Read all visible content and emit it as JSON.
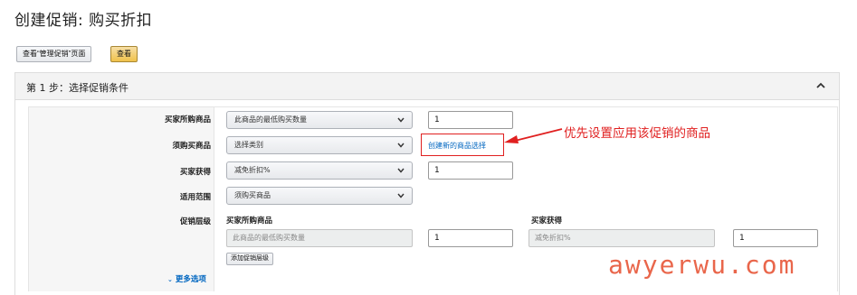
{
  "page": {
    "title": "创建促销: 购买折扣"
  },
  "toolbar": {
    "view_manage_label": "查看“管理促销”页面",
    "view_label": "查看"
  },
  "step": {
    "title": "第 1 步：选择促销条件"
  },
  "form": {
    "buyer_purchase_label": "买家所购商品",
    "buyer_purchase_select": "此商品的最低购买数量",
    "buyer_purchase_qty": "1",
    "required_items_label": "须购买商品",
    "required_items_select": "选择类别",
    "create_selection_link": "创建新的商品选择",
    "buyer_gets_label": "买家获得",
    "buyer_gets_select": "减免折扣%",
    "buyer_gets_value": "1",
    "scope_label": "适用范围",
    "scope_select": "须购买商品",
    "tiers_label": "促销层级",
    "tier_buyer_purchase_head": "买家所购商品",
    "tier_buyer_gets_head": "买家获得",
    "tier_purchase_placeholder": "此商品的最低购买数量",
    "tier_purchase_qty": "1",
    "tier_gets_placeholder": "减免折扣%",
    "tier_gets_value": "1",
    "add_tier_button": "添加促销层级",
    "more_options": "更多选项"
  },
  "annotation": {
    "text": "优先设置应用该促销的商品",
    "color": "#e02020"
  },
  "watermark": {
    "text": "awyerwu.com",
    "color": "#e85a3c"
  },
  "icons": {
    "collapse": "chevron-up-icon",
    "select_caret": "chevron-down-icon",
    "more_caret": "chevron-down-small-icon"
  }
}
